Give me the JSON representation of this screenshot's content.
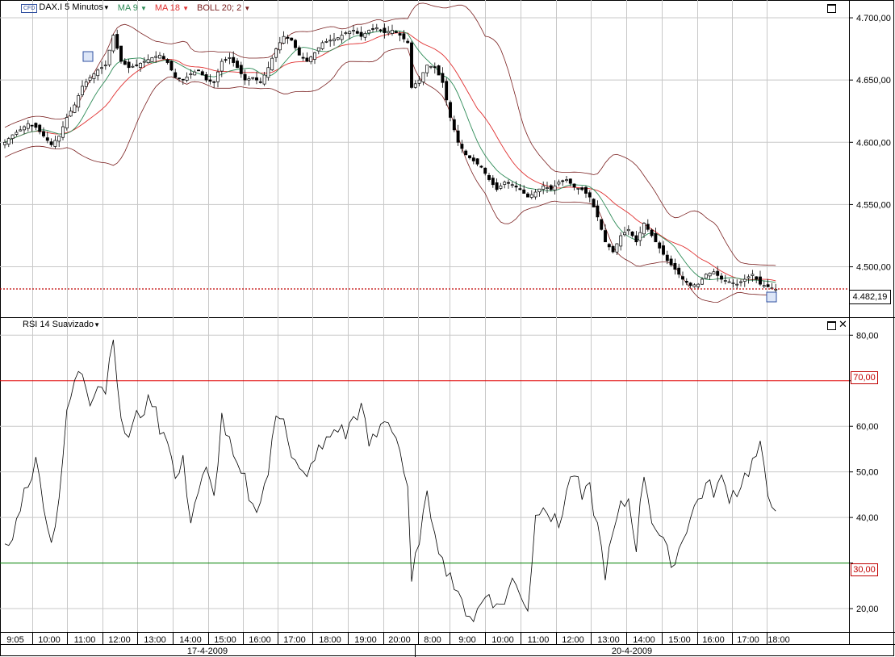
{
  "header": {
    "symbol": "DAX.I 5 Minutos",
    "ma9": "MA 9",
    "ma18": "MA 18",
    "boll": "BOLL 20; 2",
    "rsi_title": "RSI 14 Suavizado",
    "current_price": "4.482,19",
    "level_high": "70,00",
    "level_low": "30,00",
    "cfd_badge": "CFD"
  },
  "colors": {
    "ma9": "#2e8b57",
    "ma18": "#e03030",
    "boll": "#7a2020",
    "candle_up": "#ffffff",
    "candle_down": "#000000",
    "rsi": "#000000",
    "level70": "#e00000",
    "level30": "#008000",
    "grid": "#c8c8c8",
    "price_line": "#c00000"
  },
  "chart_data": [
    {
      "type": "candlestick",
      "instrument": "DAX.I",
      "interval": "5 Minutos",
      "y_ticks": [
        "4.500,00",
        "4.550,00",
        "4.600,00",
        "4.650,00",
        "4.700,00"
      ],
      "y_tick_values": [
        4500,
        4550,
        4600,
        4650,
        4700
      ],
      "ylim": [
        4466,
        4713
      ],
      "current_price": 4482.19,
      "x_time_labels": [
        "9:05",
        "10:00",
        "11:00",
        "12:00",
        "13:00",
        "14:00",
        "15:00",
        "16:00",
        "17:00",
        "18:00",
        "19:00",
        "20:00",
        "8:00",
        "9:00",
        "10:00",
        "11:00",
        "12:00",
        "13:00",
        "14:00",
        "15:00",
        "16:00",
        "17:00",
        "18:00"
      ],
      "date_labels": [
        "17-4-2009",
        "20-4-2009"
      ],
      "close_path": [
        [
          0,
          4600
        ],
        [
          2,
          4606
        ],
        [
          4,
          4610
        ],
        [
          6,
          4615
        ],
        [
          8,
          4612
        ],
        [
          10,
          4605
        ],
        [
          12,
          4598
        ],
        [
          14,
          4605
        ],
        [
          16,
          4620
        ],
        [
          18,
          4630
        ],
        [
          20,
          4645
        ],
        [
          22,
          4652
        ],
        [
          24,
          4658
        ],
        [
          26,
          4662
        ],
        [
          28,
          4686
        ],
        [
          30,
          4665
        ],
        [
          32,
          4660
        ],
        [
          34,
          4662
        ],
        [
          36,
          4665
        ],
        [
          38,
          4668
        ],
        [
          40,
          4670
        ],
        [
          42,
          4664
        ],
        [
          44,
          4652
        ],
        [
          46,
          4650
        ],
        [
          48,
          4655
        ],
        [
          50,
          4658
        ],
        [
          52,
          4650
        ],
        [
          54,
          4648
        ],
        [
          56,
          4665
        ],
        [
          58,
          4668
        ],
        [
          60,
          4660
        ],
        [
          62,
          4650
        ],
        [
          64,
          4652
        ],
        [
          66,
          4648
        ],
        [
          68,
          4660
        ],
        [
          70,
          4675
        ],
        [
          72,
          4685
        ],
        [
          74,
          4682
        ],
        [
          76,
          4670
        ],
        [
          78,
          4665
        ],
        [
          80,
          4672
        ],
        [
          82,
          4680
        ],
        [
          84,
          4682
        ],
        [
          86,
          4684
        ],
        [
          88,
          4688
        ],
        [
          90,
          4690
        ],
        [
          92,
          4685
        ],
        [
          94,
          4690
        ],
        [
          96,
          4692
        ],
        [
          98,
          4688
        ],
        [
          100,
          4690
        ],
        [
          102,
          4686
        ],
        [
          104,
          4680
        ],
        [
          105,
          4644
        ],
        [
          107,
          4650
        ],
        [
          109,
          4662
        ],
        [
          111,
          4660
        ],
        [
          113,
          4648
        ],
        [
          115,
          4620
        ],
        [
          117,
          4600
        ],
        [
          119,
          4590
        ],
        [
          121,
          4585
        ],
        [
          123,
          4580
        ],
        [
          125,
          4570
        ],
        [
          127,
          4562
        ],
        [
          129,
          4568
        ],
        [
          131,
          4566
        ],
        [
          133,
          4562
        ],
        [
          135,
          4556
        ],
        [
          137,
          4560
        ],
        [
          139,
          4565
        ],
        [
          141,
          4562
        ],
        [
          143,
          4568
        ],
        [
          145,
          4570
        ],
        [
          147,
          4564
        ],
        [
          149,
          4562
        ],
        [
          151,
          4556
        ],
        [
          153,
          4540
        ],
        [
          155,
          4520
        ],
        [
          157,
          4512
        ],
        [
          159,
          4525
        ],
        [
          161,
          4530
        ],
        [
          163,
          4520
        ],
        [
          165,
          4535
        ],
        [
          167,
          4525
        ],
        [
          169,
          4515
        ],
        [
          171,
          4505
        ],
        [
          173,
          4498
        ],
        [
          175,
          4490
        ],
        [
          177,
          4485
        ],
        [
          179,
          4486
        ],
        [
          181,
          4494
        ],
        [
          183,
          4496
        ],
        [
          185,
          4490
        ],
        [
          187,
          4488
        ],
        [
          189,
          4486
        ],
        [
          191,
          4490
        ],
        [
          193,
          4494
        ],
        [
          195,
          4486
        ],
        [
          197,
          4484
        ],
        [
          199,
          4482
        ]
      ]
    },
    {
      "type": "line",
      "title": "RSI 14 Suavizado",
      "y_ticks": [
        "20,00",
        "30,00",
        "40,00",
        "50,00",
        "60,00",
        "70,00",
        "80,00"
      ],
      "y_tick_values": [
        20,
        30,
        40,
        50,
        60,
        70,
        80
      ],
      "ylim": [
        17,
        82
      ],
      "levels": [
        70,
        30
      ],
      "x_time_labels": [
        "9:05",
        "10:00",
        "11:00",
        "12:00",
        "13:00",
        "14:00",
        "15:00",
        "16:00",
        "17:00",
        "18:00",
        "19:00",
        "20:00",
        "8:00",
        "9:00",
        "10:00",
        "11:00",
        "12:00",
        "13:00",
        "14:00",
        "15:00",
        "16:00",
        "17:00",
        "18:00"
      ],
      "rsi_path": [
        [
          0,
          33
        ],
        [
          2,
          35
        ],
        [
          4,
          43
        ],
        [
          6,
          48
        ],
        [
          8,
          52
        ],
        [
          10,
          44
        ],
        [
          12,
          34
        ],
        [
          14,
          45
        ],
        [
          16,
          62
        ],
        [
          18,
          70
        ],
        [
          20,
          72
        ],
        [
          22,
          66
        ],
        [
          24,
          70
        ],
        [
          26,
          68
        ],
        [
          28,
          81
        ],
        [
          30,
          60
        ],
        [
          32,
          58
        ],
        [
          34,
          62
        ],
        [
          36,
          64
        ],
        [
          38,
          66
        ],
        [
          40,
          60
        ],
        [
          42,
          58
        ],
        [
          44,
          48
        ],
        [
          46,
          52
        ],
        [
          48,
          40
        ],
        [
          50,
          46
        ],
        [
          52,
          50
        ],
        [
          54,
          44
        ],
        [
          56,
          62
        ],
        [
          58,
          56
        ],
        [
          60,
          50
        ],
        [
          62,
          48
        ],
        [
          64,
          42
        ],
        [
          66,
          44
        ],
        [
          68,
          50
        ],
        [
          70,
          62
        ],
        [
          72,
          63
        ],
        [
          74,
          54
        ],
        [
          76,
          50
        ],
        [
          78,
          48
        ],
        [
          80,
          54
        ],
        [
          82,
          55
        ],
        [
          84,
          58
        ],
        [
          86,
          60
        ],
        [
          88,
          58
        ],
        [
          90,
          62
        ],
        [
          92,
          64
        ],
        [
          94,
          56
        ],
        [
          96,
          58
        ],
        [
          98,
          62
        ],
        [
          100,
          60
        ],
        [
          102,
          55
        ],
        [
          104,
          45
        ],
        [
          105,
          25
        ],
        [
          107,
          36
        ],
        [
          109,
          44
        ],
        [
          111,
          38
        ],
        [
          113,
          30
        ],
        [
          115,
          28
        ],
        [
          117,
          22
        ],
        [
          119,
          20
        ],
        [
          121,
          18
        ],
        [
          123,
          21
        ],
        [
          125,
          24
        ],
        [
          127,
          20
        ],
        [
          129,
          22
        ],
        [
          131,
          26
        ],
        [
          133,
          24
        ],
        [
          135,
          20
        ],
        [
          137,
          40
        ],
        [
          139,
          44
        ],
        [
          141,
          40
        ],
        [
          143,
          38
        ],
        [
          145,
          46
        ],
        [
          147,
          50
        ],
        [
          149,
          44
        ],
        [
          151,
          46
        ],
        [
          153,
          38
        ],
        [
          155,
          28
        ],
        [
          157,
          36
        ],
        [
          159,
          42
        ],
        [
          161,
          44
        ],
        [
          163,
          34
        ],
        [
          165,
          50
        ],
        [
          167,
          40
        ],
        [
          169,
          36
        ],
        [
          171,
          32
        ],
        [
          173,
          30
        ],
        [
          175,
          36
        ],
        [
          177,
          40
        ],
        [
          179,
          44
        ],
        [
          181,
          47
        ],
        [
          183,
          46
        ],
        [
          185,
          48
        ],
        [
          187,
          45
        ],
        [
          189,
          46
        ],
        [
          191,
          49
        ],
        [
          193,
          52
        ],
        [
          195,
          55
        ],
        [
          197,
          45
        ],
        [
          199,
          43
        ]
      ]
    }
  ]
}
